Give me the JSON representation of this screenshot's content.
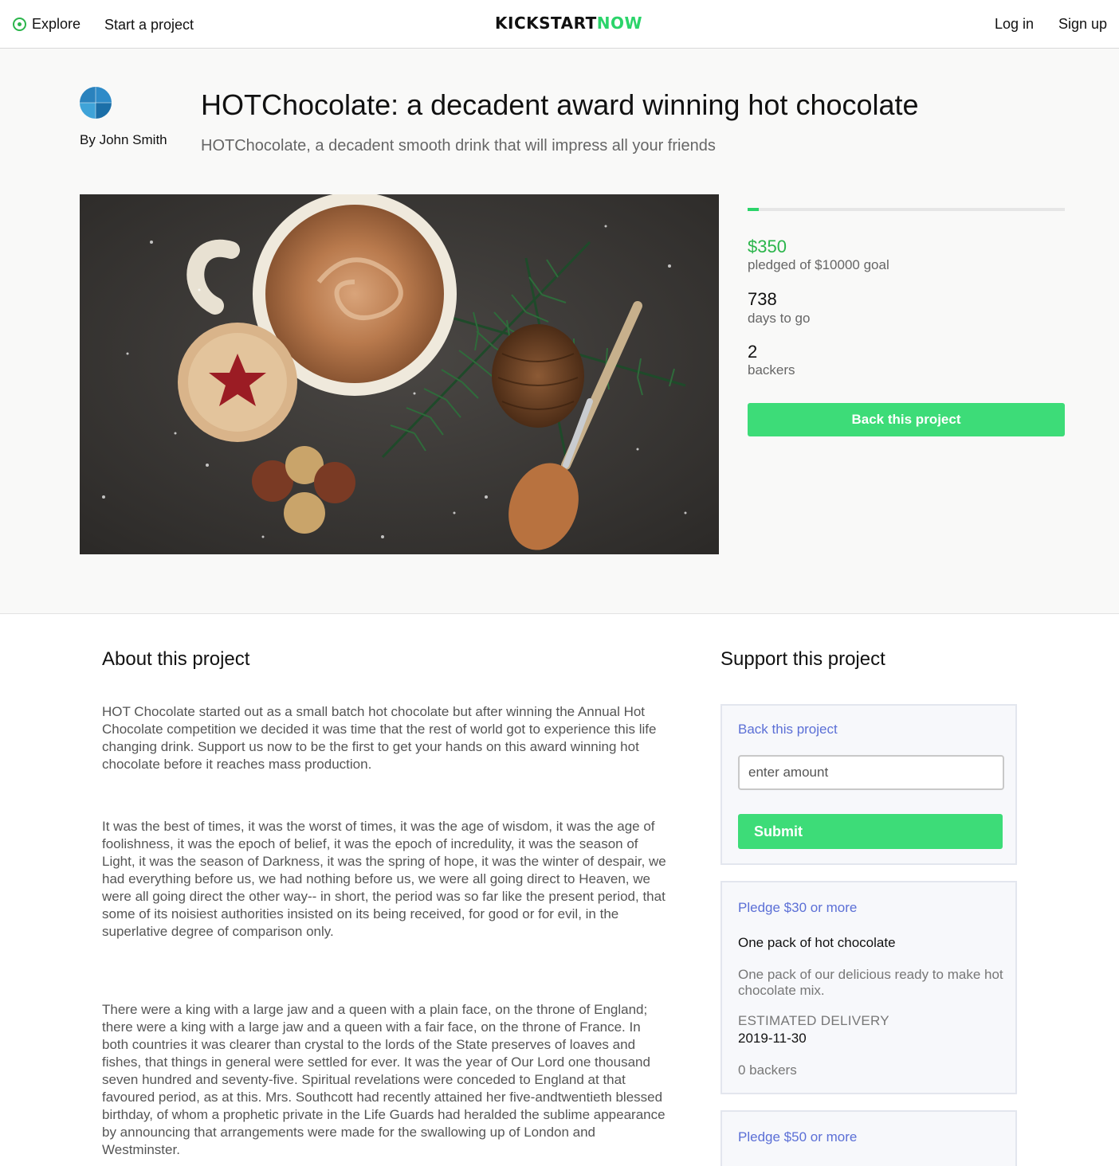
{
  "nav": {
    "explore_label": "Explore",
    "start_project_label": "Start a project",
    "logo_part1": "KICKSTART",
    "logo_part2": "NOW",
    "login_label": "Log in",
    "signup_label": "Sign up"
  },
  "project": {
    "byline_prefix": "By",
    "creator": "John Smith",
    "title": "HOTChocolate: a decadent award winning hot chocolate",
    "subtitle": "HOTChocolate, a decadent smooth drink that will impress all your friends",
    "pledged_amount": "$350",
    "pledged_label": "pledged of $10000 goal",
    "funding_progress_fraction": 0.035,
    "days_to_go": "738",
    "days_label": "days to go",
    "backers_count": "2",
    "backers_label": "backers",
    "back_button_label": "Back this project"
  },
  "about": {
    "heading": "About this project",
    "paragraphs": [
      "HOT Chocolate started out as a small batch hot chocolate but after winning the Annual Hot Chocolate competition we decided it was time that the rest of world got to experience this life changing drink. Support us now to be the first to get your hands on this award winning hot chocolate before it reaches mass production.",
      "It was the best of times, it was the worst of times, it was the age of wisdom, it was the age of foolishness, it was the epoch of belief, it was the epoch of incredulity, it was the season of Light, it was the season of Darkness, it was the spring of hope, it was the winter of despair, we had everything before us, we had nothing before us, we were all going direct to Heaven, we were all going direct the other way-- in short, the period was so far like the present period, that some of its noisiest authorities insisted on its being received, for good or for evil, in the superlative degree of comparison only.",
      "There were a king with a large jaw and a queen with a plain face, on the throne of England; there were a king with a large jaw and a queen with a fair face, on the throne of France. In both countries it was clearer than crystal to the lords of the State preserves of loaves and fishes, that things in general were settled for ever. It was the year of Our Lord one thousand seven hundred and seventy-five. Spiritual revelations were conceded to England at that favoured period, as at this. Mrs. Southcott had recently attained her five-andtwentieth blessed birthday, of whom a prophetic private in the Life Guards had heralded the sublime appearance by announcing that arrangements were made for the swallowing up of London and Westminster."
    ]
  },
  "support": {
    "heading": "Support this project",
    "back_card": {
      "link_label": "Back this project",
      "amount_placeholder": "enter amount",
      "submit_label": "Submit"
    },
    "rewards": [
      {
        "pledge_label": "Pledge $30 or more",
        "title": "One pack of hot chocolate",
        "description": "One pack of our delicious ready to make hot chocolate mix.",
        "delivery_label": "ESTIMATED DELIVERY",
        "delivery_date": "2019-11-30",
        "backers": "0 backers"
      },
      {
        "pledge_label": "Pledge $50 or more"
      }
    ]
  },
  "colors": {
    "accent_green": "#3ddc78",
    "money_green": "#2bb54b",
    "link_blue": "#5b6fd6"
  }
}
